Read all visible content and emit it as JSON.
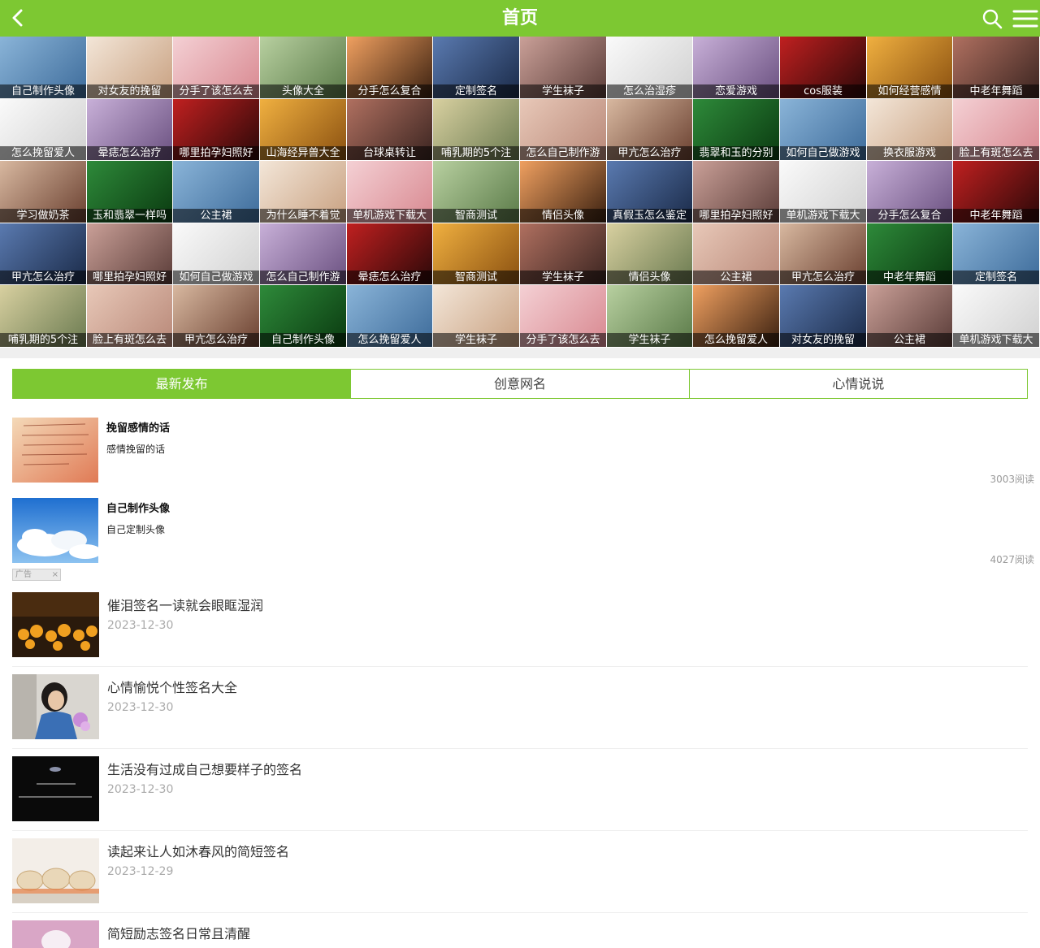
{
  "header": {
    "title": "首页"
  },
  "grid": {
    "rows": [
      [
        "自己制作头像",
        "对女友的挽留",
        "分手了该怎么去",
        "头像大全",
        "分手怎么复合",
        "定制签名",
        "学生袜子",
        "怎么治湿疹",
        "恋爱游戏",
        "cos服装",
        "如何经营感情",
        "中老年舞蹈"
      ],
      [
        "怎么挽留爱人",
        "晕痣怎么治疗",
        "哪里拍孕妇照好",
        "山海经异兽大全",
        "台球桌转让",
        "哺乳期的5个注",
        "怎么自己制作游",
        "甲亢怎么治疗",
        "翡翠和玉的分别",
        "如何自己做游戏",
        "换衣服游戏",
        "脸上有斑怎么去"
      ],
      [
        "学习做奶茶",
        "玉和翡翠一样吗",
        "公主裙",
        "为什么睡不着觉",
        "单机游戏下载大",
        "智商测试",
        "情侣头像",
        "真假玉怎么鉴定",
        "哪里拍孕妇照好",
        "单机游戏下载大",
        "分手怎么复合",
        "中老年舞蹈"
      ],
      [
        "甲亢怎么治疗",
        "哪里拍孕妇照好",
        "如何自己做游戏",
        "怎么自己制作游",
        "晕痣怎么治疗",
        "智商测试",
        "学生袜子",
        "情侣头像",
        "公主裙",
        "甲亢怎么治疗",
        "中老年舞蹈",
        "定制签名"
      ],
      [
        "哺乳期的5个注",
        "脸上有斑怎么去",
        "甲亢怎么治疗",
        "自己制作头像",
        "怎么挽留爱人",
        "学生袜子",
        "分手了该怎么去",
        "学生袜子",
        "怎么挽留爱人",
        "对女友的挽留",
        "公主裙",
        "单机游戏下载大"
      ]
    ]
  },
  "tabs": [
    {
      "label": "最新发布",
      "active": true
    },
    {
      "label": "创意网名",
      "active": false
    },
    {
      "label": "心情说说",
      "active": false
    }
  ],
  "featured": [
    {
      "title": "挽留感情的话",
      "desc": "感情挽留的话",
      "reads": "3003阅读"
    },
    {
      "title": "自己制作头像",
      "desc": "自己定制头像",
      "reads": "4027阅读"
    }
  ],
  "ad": {
    "label": "广告",
    "close": "×"
  },
  "articles": [
    {
      "title": "催泪签名一读就会眼眶湿润",
      "date": "2023-12-30"
    },
    {
      "title": "心情愉悦个性签名大全",
      "date": "2023-12-30"
    },
    {
      "title": "生活没有过成自己想要样子的签名",
      "date": "2023-12-30"
    },
    {
      "title": "读起来让人如沐春风的简短签名",
      "date": "2023-12-29"
    },
    {
      "title": "简短励志签名日常且清醒",
      "date": ""
    }
  ],
  "colors": {
    "brand": "#7dc832",
    "caption_bg": "rgba(0,0,0,0.55)"
  }
}
